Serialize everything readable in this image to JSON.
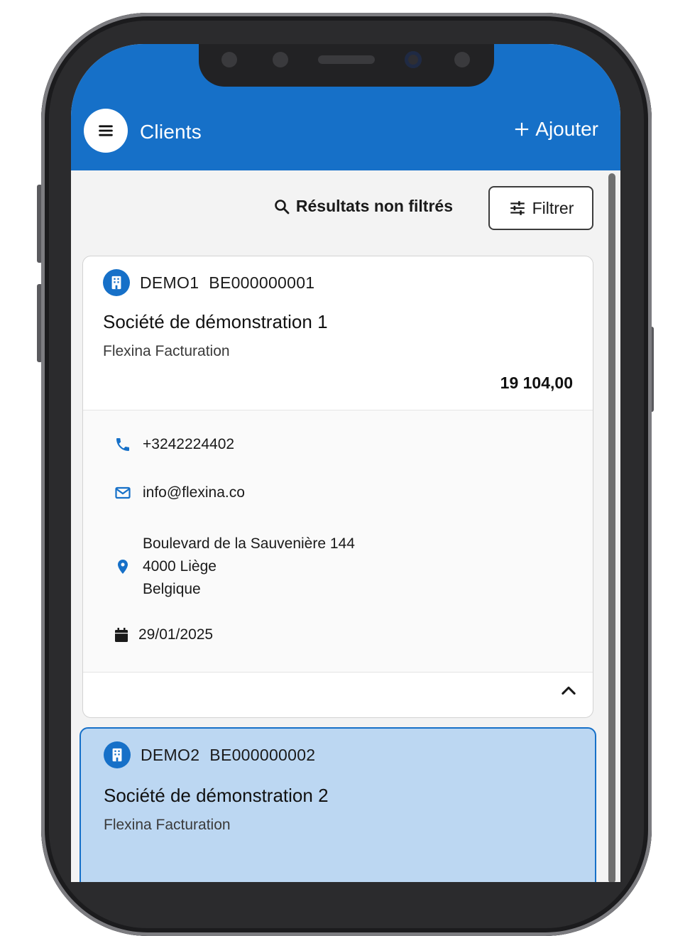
{
  "app": {
    "title": "Clients",
    "add_label": "Ajouter"
  },
  "toolbar": {
    "results_label": "Résultats non filtrés",
    "filter_label": "Filtrer"
  },
  "colors": {
    "primary": "#1670c8",
    "selected_card_bg": "#bcd7f2"
  },
  "clients": [
    {
      "code": "DEMO1",
      "vat": "BE000000001",
      "name": "Société de démonstration 1",
      "company": "Flexina Facturation",
      "amount": "19 104,00",
      "phone": "+3242224402",
      "email": "info@flexina.co",
      "address": {
        "street": "Boulevard de la Sauvenière 144",
        "city": "4000 Liège",
        "country": "Belgique"
      },
      "date": "29/01/2025",
      "expanded": true
    },
    {
      "code": "DEMO2",
      "vat": "BE000000002",
      "name": "Société de démonstration 2",
      "company": "Flexina Facturation",
      "selected": true
    }
  ]
}
